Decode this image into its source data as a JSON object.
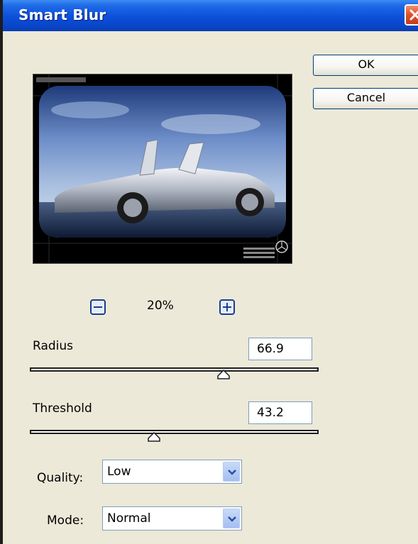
{
  "window": {
    "title": "Smart Blur"
  },
  "buttons": {
    "ok": "OK",
    "cancel": "Cancel"
  },
  "preview": {
    "zoom_level": "20%"
  },
  "radius": {
    "label": "Radius",
    "value": "66.9",
    "slider_fraction": 0.67
  },
  "threshold": {
    "label": "Threshold",
    "value": "43.2",
    "slider_fraction": 0.43
  },
  "quality": {
    "label": "Quality:",
    "selected": "Low"
  },
  "mode": {
    "label": "Mode:",
    "selected": "Normal"
  },
  "icons": {
    "close": "close-icon",
    "zoom_out": "minus-icon",
    "zoom_in": "plus-icon",
    "dropdown": "chevron-down-icon"
  },
  "colors": {
    "titlebar": "#0c4fd8",
    "dialog_bg": "#ece9d8",
    "close_button": "#df4f27"
  }
}
